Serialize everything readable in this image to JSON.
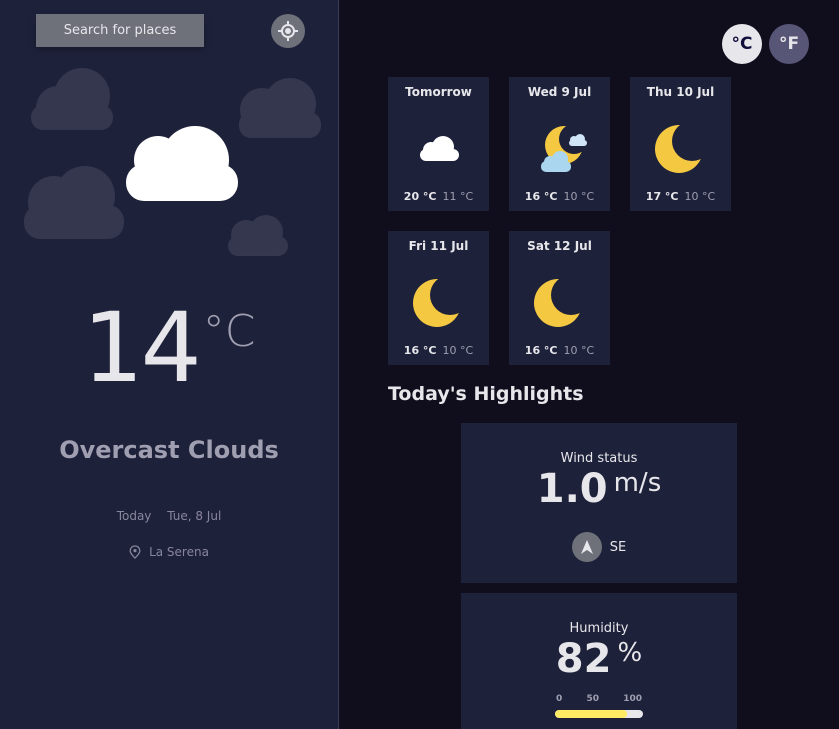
{
  "sidebar": {
    "search_label": "Search for places",
    "locate_icon": "crosshair-icon",
    "current": {
      "temp": "14",
      "unit": "°C",
      "condition": "Overcast Clouds",
      "day_label": "Today",
      "date": "Tue, 8 Jul",
      "location": "La Serena"
    }
  },
  "units": {
    "celsius": "°C",
    "fahrenheit": "°F"
  },
  "forecast": [
    {
      "day": "Tomorrow",
      "max": "20 °C",
      "min": "11 °C",
      "icon": "cloud-icon"
    },
    {
      "day": "Wed 9 Jul",
      "max": "16 °C",
      "min": "10 °C",
      "icon": "moon-cloud-icon"
    },
    {
      "day": "Thu 10 Jul",
      "max": "17 °C",
      "min": "10 °C",
      "icon": "moon-icon"
    },
    {
      "day": "Fri 11 Jul",
      "max": "16 °C",
      "min": "10 °C",
      "icon": "moon-icon"
    },
    {
      "day": "Sat 12 Jul",
      "max": "16 °C",
      "min": "10 °C",
      "icon": "moon-icon"
    }
  ],
  "highlights": {
    "title": "Today's Highlights",
    "wind": {
      "label": "Wind status",
      "value": "1.0",
      "unit": "m/s",
      "direction": "SE"
    },
    "humidity": {
      "label": "Humidity",
      "value": "82",
      "unit": "%",
      "scale": [
        "0",
        "50",
        "100"
      ],
      "percent": 82
    }
  },
  "colors": {
    "background": "#100e1d",
    "panel": "#1e213a",
    "bar": "#ffec65",
    "moon": "#f5c842"
  }
}
